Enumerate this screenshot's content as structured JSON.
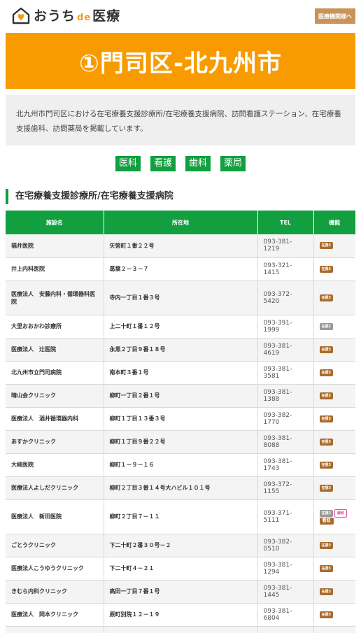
{
  "header": {
    "logo": {
      "part1": "おうち",
      "part2": "de",
      "part3": "医療"
    },
    "button_label": "医療機関様へ"
  },
  "banner": {
    "title": "①門司区-北九州市"
  },
  "intro": {
    "text": "北九州市門司区における在宅療養支援診療所/在宅療養支援病院、訪問看護ステーション、在宅療養支援歯科、訪問薬局を掲載しています。"
  },
  "categories": [
    "医科",
    "看護",
    "歯科",
    "薬局"
  ],
  "section": {
    "title": "在宅療養支援診療所/在宅療養支援病院"
  },
  "table": {
    "headers": [
      "施設名",
      "所在地",
      "TEL",
      "機能"
    ],
    "rows": [
      {
        "name": "福井医院",
        "address": "矢筈町１番２２号",
        "tel": "093-381-1219",
        "tags": [
          "在援3"
        ]
      },
      {
        "name": "井上内科医院",
        "address": "葛葉２－３－７",
        "tel": "093-321-1415",
        "tags": [
          "在援3"
        ]
      },
      {
        "name": "医療法人　安藤内科・循環器科医院",
        "address": "寺内一丁目１番３号",
        "tel": "093-372-5420",
        "tags": [
          "在援3"
        ]
      },
      {
        "name": "大里おおかわ診療所",
        "address": "上二十町１番１２号",
        "tel": "093-391-1999",
        "tags": [
          "在援2"
        ]
      },
      {
        "name": "医療法人　辻医院",
        "address": "永黒２丁目９番１８号",
        "tel": "093-381-4619",
        "tags": [
          "在援3"
        ]
      },
      {
        "name": "北九州市立門司病院",
        "address": "南本町３番１号",
        "tel": "093-381-3581",
        "tags": [
          "在援3"
        ]
      },
      {
        "name": "晴山会クリニック",
        "address": "柳町一丁目２番１号",
        "tel": "093-381-1388",
        "tags": [
          "在援3"
        ]
      },
      {
        "name": "医療法人　酒井循環器内科",
        "address": "柳町１丁目１３番３号",
        "tel": "093-382-1770",
        "tags": [
          "在援3"
        ]
      },
      {
        "name": "あすかクリニック",
        "address": "柳町１丁目９番２２号",
        "tel": "093-381-8088",
        "tags": [
          "在援3"
        ]
      },
      {
        "name": "大崎医院",
        "address": "柳町１－９－１６",
        "tel": "093-381-1743",
        "tags": [
          "在援3"
        ]
      },
      {
        "name": "医療法人よしだクリニック",
        "address": "柳町２丁目３番１４号大ハビル１０１号",
        "tel": "093-372-1155",
        "tags": [
          "在援3"
        ]
      },
      {
        "name": "医療法人　新田医院",
        "address": "柳町２丁目７－１１",
        "tel": "093-371-5111",
        "tags": [
          "在援2",
          "緩和",
          "看取"
        ]
      },
      {
        "name": "ごとうクリニック",
        "address": "下二十町２番３０号－２",
        "tel": "093-382-0510",
        "tags": [
          "在援3"
        ]
      },
      {
        "name": "医療法人こうゆうクリニック",
        "address": "下二十町４－２１",
        "tel": "093-381-1294",
        "tags": [
          "在援3"
        ]
      },
      {
        "name": "きむら内科クリニック",
        "address": "高田一丁目７番１号",
        "tel": "093-381-1445",
        "tags": [
          "在援3"
        ]
      },
      {
        "name": "医療法人　岡本クリニック",
        "address": "原町別院１２－１９",
        "tel": "093-381-6804",
        "tags": [
          "在援3"
        ]
      },
      {
        "name": "",
        "address": "",
        "tel": "",
        "tags": []
      }
    ]
  },
  "colors": {
    "green": "#119f3f",
    "orange": "#f79b00",
    "brown": "#a86b2e",
    "header_button": "#c9935a"
  }
}
